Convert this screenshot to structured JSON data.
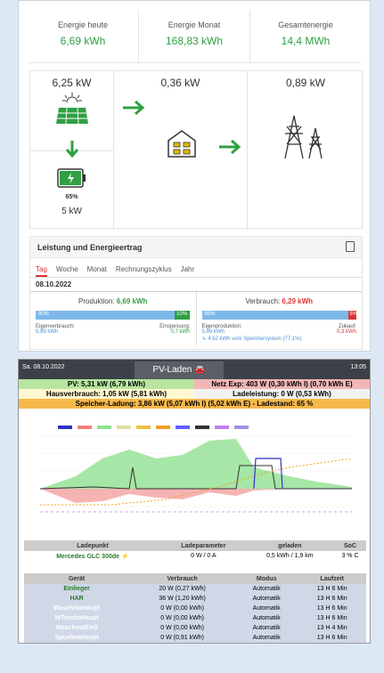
{
  "stats": [
    {
      "label": "Energie heute",
      "value": "6,69 kWh"
    },
    {
      "label": "Energie Monat",
      "value": "168,83 kWh"
    },
    {
      "label": "Gesamtenergie",
      "value": "14,4 MWh"
    }
  ],
  "flow": {
    "pv": "6,25 kW",
    "house": "0,36 kW",
    "grid": "0,89 kW",
    "battery_pct": "65%",
    "battery_kw": "5 kW"
  },
  "card": {
    "title": "Leistung und Energieertrag",
    "tabs": [
      "Tag",
      "Woche",
      "Monat",
      "Rechnungszyklus",
      "Jahr"
    ],
    "date": "08.10.2022",
    "produktion_label": "Produktion:",
    "produktion_val": "6,69 kWh",
    "verbrauch_label": "Verbrauch:",
    "verbrauch_val": "6,29 kWh",
    "prod_bar_a": "90%",
    "prod_bar_b": "10%",
    "verb_bar_a": "95%",
    "verb_bar_b": "5%",
    "eigenverbrauch_label": "Eigenverbrauch:",
    "eigenverbrauch_val": "5,99 kWh",
    "einspeisung_label": "Einspeisung:",
    "einspeisung_val": "0,7 kWh",
    "eigenproduktion_label": "Eigenproduktion:",
    "eigenproduktion_val": "5,99 kWh",
    "zukauf_label": "Zukauf:",
    "zukauf_val": "0,3 kWh",
    "speicher_note": "↳ 4,62 kWh vom Speichersystem (77,1%)"
  },
  "pv_panel": {
    "date": "Sa. 08.10.2022",
    "title": "PV-Laden 🚘",
    "time": "13:05",
    "pv": "PV: 5,31 kW (6,79 kWh)",
    "netz": "Netz Exp: 403 W (0,30 kWh I) (0,70 kWh E)",
    "haus": "Hausverbrauch: 1,05 kW (5,81 kWh)",
    "lade": "Ladeleistung: 0 W (0,53 kWh)",
    "speicher": "Speicher-Ladung: 3,86 kW (5,07 kWh I) (5,02 kWh E) - Ladestand: 65 %",
    "ladepunkt_head": [
      "Ladepunkt",
      "Ladeparameter",
      "geladen",
      "SoC"
    ],
    "ladepunkt_row": [
      "Mercedes GLC 300de ⚡",
      "0 W / 0 A",
      "0,5 kWh / 1,9 km",
      "3 % C"
    ],
    "geraet_head": [
      "Gerät",
      "Verbrauch",
      "Modus",
      "Laufzeit"
    ],
    "geraete": [
      [
        "Einlieger",
        "20 W (0,27 kWh)",
        "Automatik",
        "13 H 6 Min"
      ],
      [
        "HAR",
        "36 W (1,20 kWh)",
        "Automatik",
        "13 H 6 Min"
      ],
      [
        "WaschmaHaupt",
        "0 W (0,00 kWh)",
        "Automatik",
        "13 H 6 Min"
      ],
      [
        "WTrocknHaupt",
        "0 W (0,00 kWh)",
        "Automatik",
        "13 H 6 Min"
      ],
      [
        "WaschmaEinli",
        "0 W (0,00 kWh)",
        "Automatik",
        "13 H 4 Min"
      ],
      [
        "SpuelmaHaupt",
        "0 W (0,91 kWh)",
        "Automatik",
        "13 H 6 Min"
      ]
    ]
  },
  "colors": {
    "green": "#2ea043",
    "red": "#d33",
    "blue": "#7eb8ea"
  }
}
